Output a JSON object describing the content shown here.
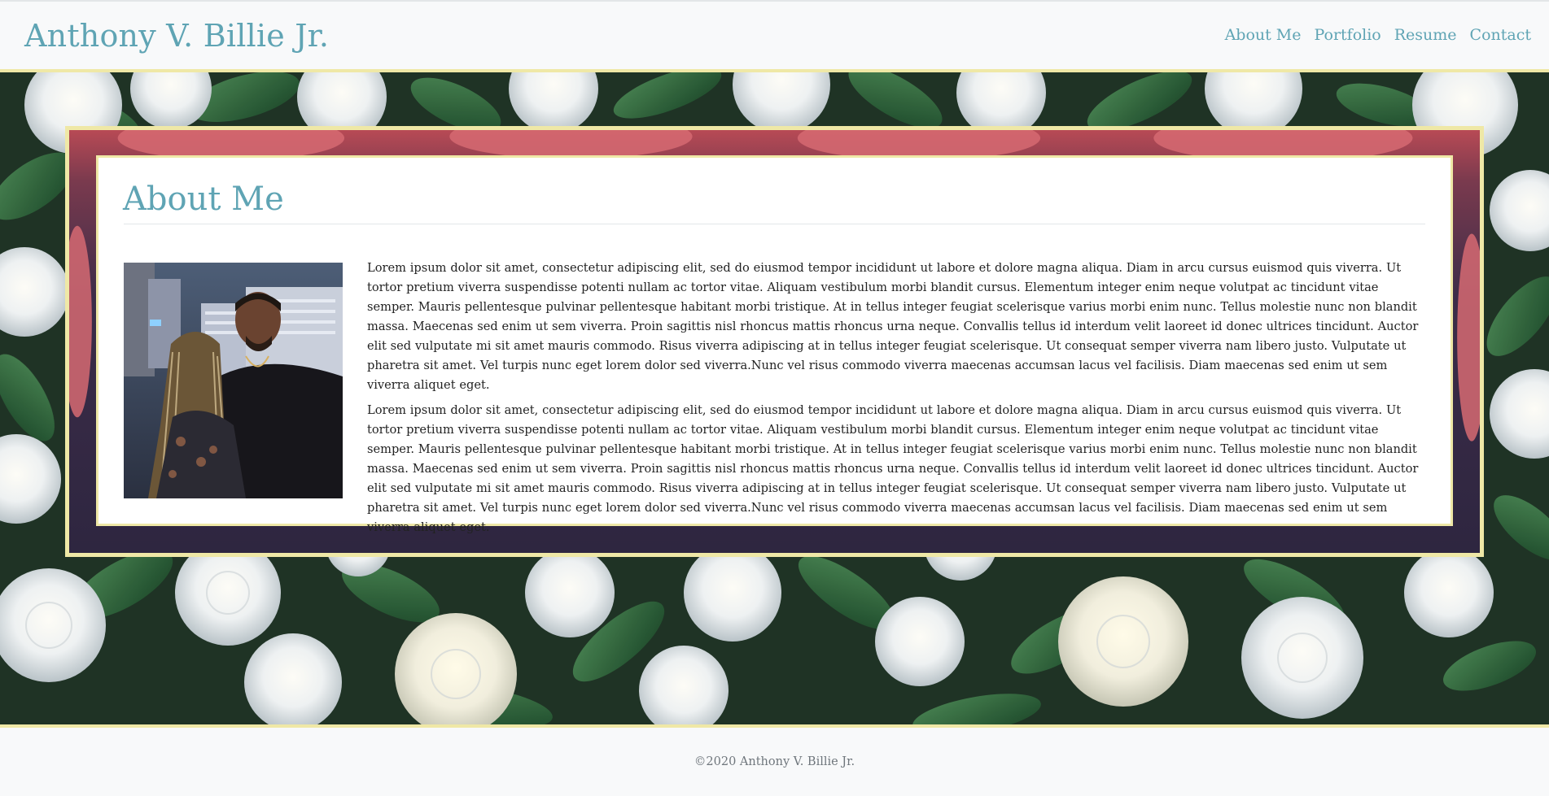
{
  "header": {
    "brand": "Anthony V. Billie Jr.",
    "nav": [
      "About Me",
      "Portfolio",
      "Resume",
      "Contact"
    ]
  },
  "about": {
    "title": "About Me",
    "photo_icon": "couple-photo",
    "paragraphs": [
      "Lorem ipsum dolor sit amet, consectetur adipiscing elit, sed do eiusmod tempor incididunt ut labore et dolore magna aliqua. Diam in arcu cursus euismod quis viverra. Ut tortor pretium viverra suspendisse potenti nullam ac tortor vitae. Aliquam vestibulum morbi blandit cursus. Elementum integer enim neque volutpat ac tincidunt vitae semper. Mauris pellentesque pulvinar pellentesque habitant morbi tristique. At in tellus integer feugiat scelerisque varius morbi enim nunc. Tellus molestie nunc non blandit massa. Maecenas sed enim ut sem viverra. Proin sagittis nisl rhoncus mattis rhoncus urna neque. Convallis tellus id interdum velit laoreet id donec ultrices tincidunt. Auctor elit sed vulputate mi sit amet mauris commodo. Risus viverra adipiscing at in tellus integer feugiat scelerisque. Ut consequat semper viverra nam libero justo. Vulputate ut pharetra sit amet. Vel turpis nunc eget lorem dolor sed viverra.Nunc vel risus commodo viverra maecenas accumsan lacus vel facilisis. Diam maecenas sed enim ut sem viverra aliquet eget.",
      "Lorem ipsum dolor sit amet, consectetur adipiscing elit, sed do eiusmod tempor incididunt ut labore et dolore magna aliqua. Diam in arcu cursus euismod quis viverra. Ut tortor pretium viverra suspendisse potenti nullam ac tortor vitae. Aliquam vestibulum morbi blandit cursus. Elementum integer enim neque volutpat ac tincidunt vitae semper. Mauris pellentesque pulvinar pellentesque habitant morbi tristique. At in tellus integer feugiat scelerisque varius morbi enim nunc. Tellus molestie nunc non blandit massa. Maecenas sed enim ut sem viverra. Proin sagittis nisl rhoncus mattis rhoncus urna neque. Convallis tellus id interdum velit laoreet id donec ultrices tincidunt. Auctor elit sed vulputate mi sit amet mauris commodo. Risus viverra adipiscing at in tellus integer feugiat scelerisque. Ut consequat semper viverra nam libero justo. Vulputate ut pharetra sit amet. Vel turpis nunc eget lorem dolor sed viverra.Nunc vel risus commodo viverra maecenas accumsan lacus vel facilisis. Diam maecenas sed enim ut sem viverra aliquet eget."
    ]
  },
  "footer": {
    "copyright": "©2020 Anthony V. Billie Jr."
  },
  "colors": {
    "accent": "#5fa4b4",
    "border": "#efe8a6",
    "background": "#f8f9fa"
  }
}
